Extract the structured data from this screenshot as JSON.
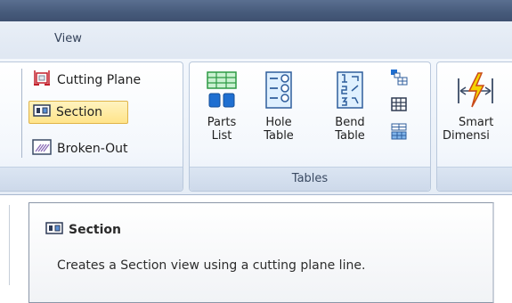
{
  "ribbon": {
    "tab_label": "View",
    "view_group": {
      "cutting_plane_label": "Cutting Plane",
      "section_label": "Section",
      "broken_out_label": "Broken-Out"
    },
    "tables_group": {
      "name": "Tables",
      "parts_list": [
        "Parts",
        "List"
      ],
      "hole_table": [
        "Hole",
        "Table"
      ],
      "bend_table": [
        "Bend",
        "Table"
      ]
    },
    "dimension_group": {
      "smart_dimension": [
        "Smart",
        "Dimensi"
      ]
    }
  },
  "tooltip": {
    "title": "Section",
    "description": "Creates a Section view using a cutting plane line."
  },
  "colors": {
    "title_bar": "#465a7a",
    "active_highlight": "#ffe48a",
    "icon_blue": "#1f6fd1"
  }
}
